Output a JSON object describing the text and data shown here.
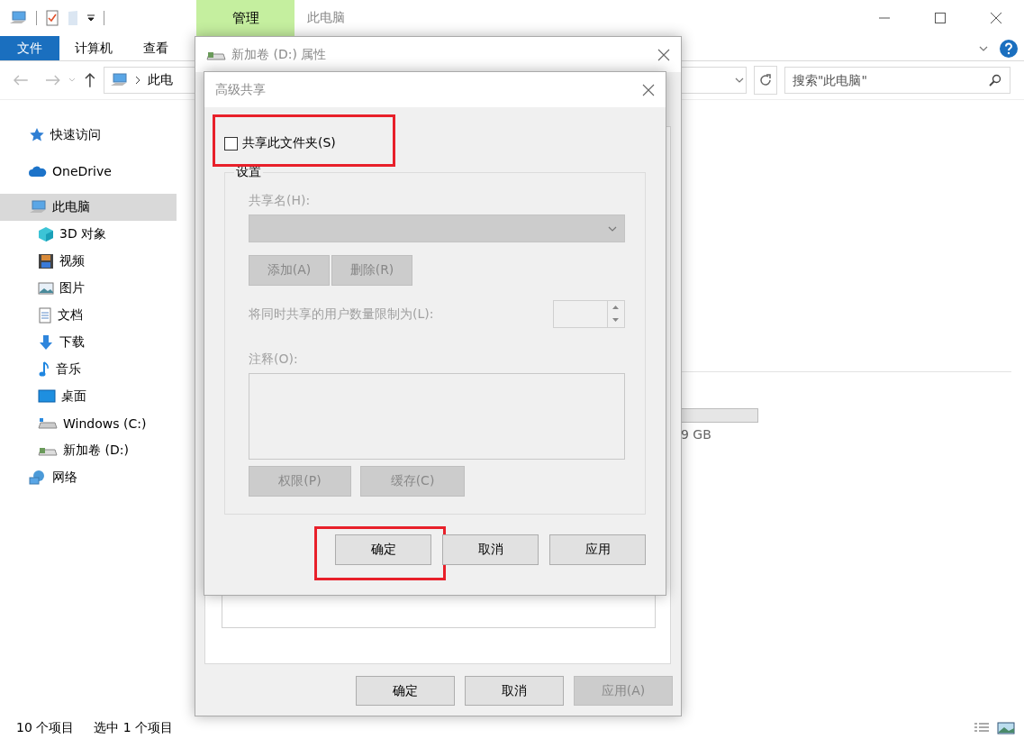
{
  "explorer": {
    "context_tab": "管理",
    "window_title": "此电脑",
    "ribbon_tabs": [
      {
        "label": "文件",
        "selected": true
      },
      {
        "label": "计算机",
        "selected": false
      },
      {
        "label": "查看",
        "selected": false
      }
    ],
    "address": "此电",
    "search": {
      "placeholder": "搜索\"此电脑\""
    },
    "sidebar": [
      {
        "label": "快速访问",
        "selected": false
      },
      {
        "label": "OneDrive",
        "selected": false
      },
      {
        "label": "此电脑",
        "selected": true,
        "children": [
          {
            "label": "3D 对象",
            "selected": false
          },
          {
            "label": "视频",
            "selected": false
          },
          {
            "label": "图片",
            "selected": false
          },
          {
            "label": "文档",
            "selected": false
          },
          {
            "label": "下载",
            "selected": false
          },
          {
            "label": "音乐",
            "selected": false
          },
          {
            "label": "桌面",
            "selected": false
          },
          {
            "label": "Windows (C:)",
            "selected": false
          },
          {
            "label": "新加卷 (D:)",
            "selected": false
          }
        ]
      },
      {
        "label": "网络",
        "selected": false
      }
    ],
    "drive_size": "9 GB",
    "status_bar": {
      "item_count": "10 个项目",
      "selection": "选中 1 个项目"
    }
  },
  "properties_dialog": {
    "title": "新加卷 (D:) 属性",
    "buttons": [
      {
        "label": "确定",
        "disabled": false
      },
      {
        "label": "取消",
        "disabled": false
      },
      {
        "label": "应用(A)",
        "disabled": true
      }
    ]
  },
  "sharing_dialog": {
    "title": "高级共享",
    "share_checkbox": {
      "label": "共享此文件夹(S)",
      "checked": false,
      "highlighted": true
    },
    "settings": {
      "title": "设置",
      "disabled": true,
      "share_name_label": "共享名(H):",
      "add_button": "添加(A)",
      "remove_button": "删除(R)",
      "limit_label": "将同时共享的用户数量限制为(L):",
      "comment_label": "注释(O):",
      "permissions_button": "权限(P)",
      "cache_button": "缓存(C)"
    },
    "buttons": [
      {
        "label": "确定",
        "highlighted": true
      },
      {
        "label": "取消",
        "highlighted": false
      },
      {
        "label": "应用",
        "highlighted": false
      }
    ]
  }
}
